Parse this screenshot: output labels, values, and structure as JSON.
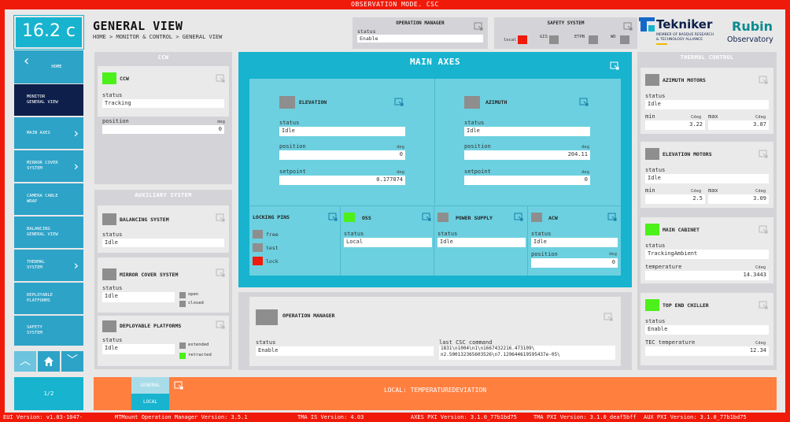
{
  "banner": "OBSERVATION MODE. CSC",
  "temperature": "16.2 c",
  "page_title": "GENERAL VIEW",
  "breadcrumb": "HOME > MONITOR & CONTROL > GENERAL VIEW",
  "top_operation_manager": {
    "title": "OPERATION MANAGER",
    "status_label": "status",
    "status": "Enable"
  },
  "safety_system": {
    "title": "SAFETY SYSTEM",
    "items": [
      "local",
      "GIS",
      "ETPB",
      "WD"
    ]
  },
  "logos": {
    "tekniker": "Tekniker",
    "tekniker_sub1": "MEMBER OF BASQUE RESEARCH",
    "tekniker_sub2": "& TECHNOLOGY ALLIANCE",
    "rubin1": "Rubin",
    "rubin2": "Observatory"
  },
  "sidebar": {
    "items": [
      {
        "line1": "HOME",
        "line2": ""
      },
      {
        "line1": "MONITOR",
        "line2": "GENERAL VIEW"
      },
      {
        "line1": "MAIN AXES",
        "line2": ""
      },
      {
        "line1": "MIRROR COVER",
        "line2": "SYSTEM"
      },
      {
        "line1": "CAMERA CABLE",
        "line2": "WRAP"
      },
      {
        "line1": "BALANCING",
        "line2": "GENERAL VIEW"
      },
      {
        "line1": "THERMAL",
        "line2": "SYSTEM"
      },
      {
        "line1": "DEPLOYABLE",
        "line2": "PLATFORMS"
      },
      {
        "line1": "SAFETY",
        "line2": "SYSTEM"
      }
    ],
    "page": "1/2"
  },
  "ccw": {
    "panel_title": "CCW",
    "title": "CCW",
    "status_label": "status",
    "status": "Tracking",
    "position_label": "position",
    "position_unit": "deg",
    "position": "0"
  },
  "aux": {
    "panel_title": "AUXILIARY SYSTEM",
    "balancing": {
      "title": "BALANCING SYSTEM",
      "status_label": "status",
      "status": "Idle"
    },
    "mirror": {
      "title": "MIRROR COVER SYSTEM",
      "status_label": "status",
      "status": "Idle",
      "open": "open",
      "closed": "closed"
    },
    "deploy": {
      "title": "DEPLOYABLE PLATFORMS",
      "status_label": "status",
      "status": "Idle",
      "extended": "extended",
      "retracted": "retracted"
    }
  },
  "main_axes": {
    "title": "MAIN AXES",
    "elevation": {
      "title": "ELEVATION",
      "status_label": "status",
      "status": "Idle",
      "position_label": "position",
      "position_unit": "deg",
      "position": "0",
      "setpoint_label": "setpoint",
      "setpoint_unit": "deg",
      "setpoint": "0.177074"
    },
    "azimuth": {
      "title": "AZIMUTH",
      "status_label": "status",
      "status": "Idle",
      "position_label": "position",
      "position_unit": "deg",
      "position": "204.11",
      "setpoint_label": "setpoint",
      "setpoint_unit": "deg",
      "setpoint": "0"
    },
    "locking": {
      "title": "LOCKING PINS",
      "free": "free",
      "test": "test",
      "lock": "lock"
    },
    "oss": {
      "title": "OSS",
      "status_label": "status",
      "status": "Local"
    },
    "power": {
      "title": "POWER SUPPLY",
      "status_label": "status",
      "status": "Idle"
    },
    "acw": {
      "title": "ACW",
      "status_label": "status",
      "status": "Idle",
      "position_label": "position",
      "position_unit": "deg",
      "position": "0"
    }
  },
  "bottom_om": {
    "title": "OPERATION MANAGER",
    "status_label": "status",
    "status": "Enable",
    "cmd_label": "last CSC command",
    "cmd_line1": "1831\\n1004\\n1\\n1667432216.473109\\",
    "cmd_line2": "n2.500132365603526\\n7.129644619595437e-05\\"
  },
  "thermal": {
    "panel_title": "THERMAL CONTROL",
    "azimuth_motors": {
      "title": "AZIMUTH MOTORS",
      "status_label": "status",
      "status": "Idle",
      "min_label": "min",
      "max_label": "max",
      "unit": "Cdeg",
      "min": "3.22",
      "max": "3.87"
    },
    "elevation_motors": {
      "title": "ELEVATION MOTORS",
      "status_label": "status",
      "status": "Idle",
      "min_label": "min",
      "max_label": "max",
      "unit": "Cdeg",
      "min": "2.5",
      "max": "3.09"
    },
    "main_cabinet": {
      "title": "MAIN CABINET",
      "status_label": "status",
      "status": "TrackingAmbient",
      "temp_label": "temperature",
      "unit": "Cdeg",
      "temp": "14.3443"
    },
    "top_end_chiller": {
      "title": "TOP END CHILLER",
      "status_label": "status",
      "status": "Enable",
      "temp_label": "TEC temperature",
      "unit": "Cdeg",
      "temp": "12.34"
    }
  },
  "bottom_bar": {
    "tab_general": "GENERAL",
    "tab_local": "LOCAL",
    "message": "LOCAL: TEMPERATUREDEVIATION"
  },
  "footer": {
    "f1": "EUI Version: v1.03-1047-",
    "f2": "MTMount Operation Manager Version: 3.5.1",
    "f3": "TMA IS Version: 4.03",
    "f4": "AXES PXI Version: 3.1.0_77b1bd75",
    "f5": "TMA PXI Version: 3.1.0_deaf5bff",
    "f6": "AUX PXI Version: 3.1.0_77b1bd75"
  },
  "colors": {
    "accent": "#2da3c8",
    "alarm": "#f01a0a",
    "ok": "#4cf01a",
    "orange": "#ff7f3f"
  }
}
